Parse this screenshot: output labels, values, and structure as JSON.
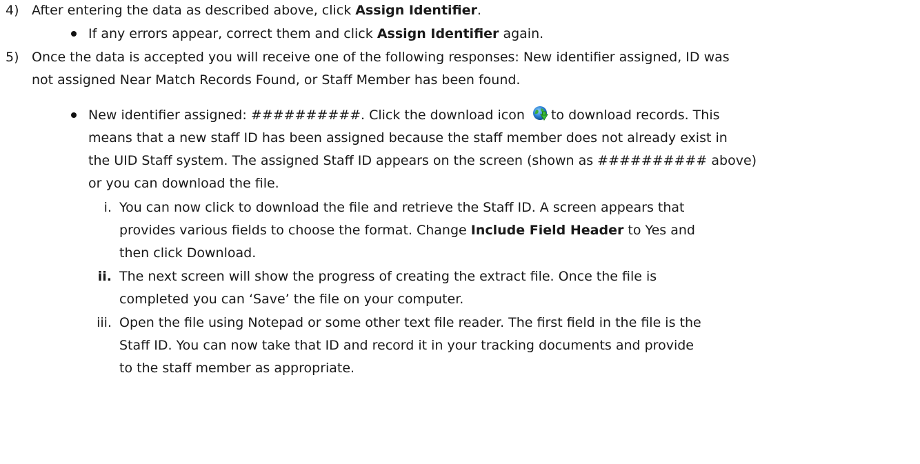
{
  "step4": {
    "number": "4)",
    "text_pre": "After entering the data as described above, click ",
    "bold": "Assign Identifier",
    "text_post": ".",
    "bullet": {
      "text_pre": "If any errors appear, correct them and click ",
      "bold": "Assign Identifier",
      "text_post": " again."
    }
  },
  "step5": {
    "number": "5)",
    "line1": "Once the data is accepted you will receive one of the following responses: New identifier assigned, ID was",
    "line2": "not assigned Near Match Records Found, or Staff Member has been found.",
    "bullet": {
      "line1_pre": "New identifier assigned: ##########. Click the download icon ",
      "line1_post": "to download records. This",
      "line2": "means that a new staff ID has been assigned because the staff member does not already exist in",
      "line3": "the UID Staff system. The assigned Staff ID appears on the screen (shown as ########## above)",
      "line4": "or you can download the file.",
      "icon": "download-globe-icon"
    },
    "subitems": [
      {
        "marker": "i.",
        "line1": "You can now click to download the file and retrieve the Staff ID. A screen appears that",
        "line2_pre": "provides various fields to choose the format.  Change ",
        "line2_bold": "Include Field Header",
        "line2_post": " to Yes and",
        "line3": "then click Download."
      },
      {
        "marker": "ii.",
        "line1": "The next screen will show the progress of creating the extract file.  Once the file is",
        "line2": "completed you can ‘Save’ the file on your computer."
      },
      {
        "marker": "iii.",
        "line1": "Open the file using Notepad or some other text file reader. The first field in the file is the",
        "line2": "Staff ID.  You can now take that ID and record it in your tracking documents and provide",
        "line3": "to the staff member as appropriate."
      }
    ]
  }
}
